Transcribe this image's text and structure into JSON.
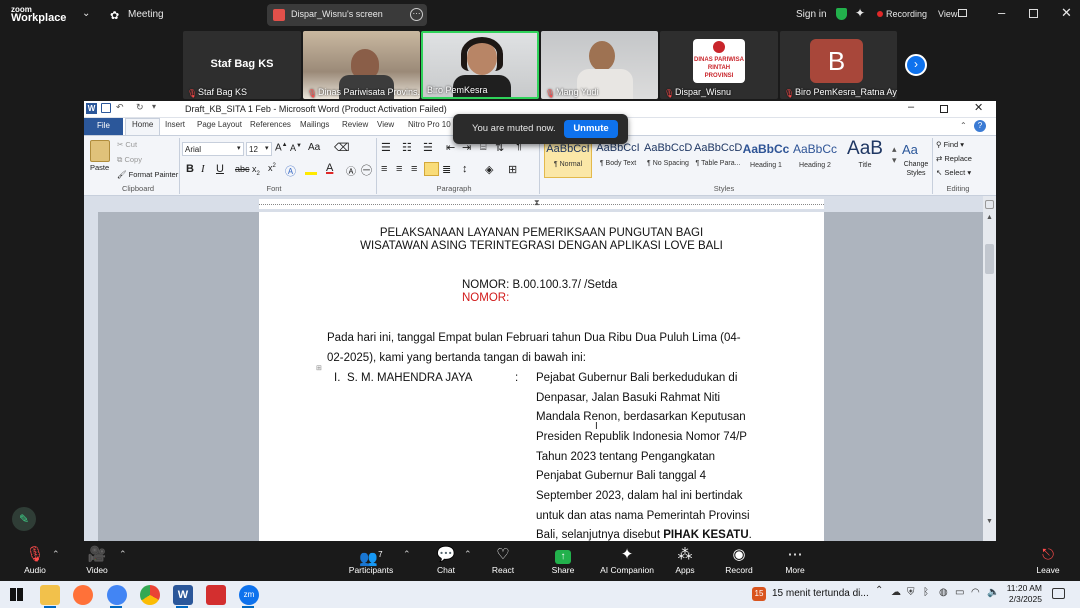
{
  "zoom": {
    "brand_line1": "zoom",
    "brand_line2": "Workplace",
    "meeting_label": "Meeting",
    "share_title": "Dispar_Wisnu's screen",
    "signin": "Sign in",
    "recording": "Recording",
    "view": "View"
  },
  "participants": [
    {
      "name": "Staf Bag KS",
      "placeholder": "Staf Bag KS"
    },
    {
      "name": "Dinas Pariwisata Provins..."
    },
    {
      "name": "Biro PemKesra"
    },
    {
      "name": "Mang Yudi"
    },
    {
      "name": "Dispar_Wisnu",
      "logo_text": "DINAS PARIWISA\nRINTAH PROVINSI"
    },
    {
      "name": "Biro PemKesra_Ratna Ayu",
      "initial": "B"
    }
  ],
  "word": {
    "title": "Draft_KB_SITA 1 Feb  -  Microsoft Word (Product Activation Failed)",
    "tabs": [
      "File",
      "Home",
      "Insert",
      "Page Layout",
      "References",
      "Mailings",
      "Review",
      "View",
      "Nitro Pro 10"
    ],
    "clipboard": {
      "paste": "Paste",
      "cut": "Cut",
      "copy": "Copy",
      "format_painter": "Format Painter",
      "group": "Clipboard"
    },
    "font": {
      "name": "Arial",
      "size": "12",
      "group": "Font"
    },
    "paragraph_group": "Paragraph",
    "styles": [
      {
        "sample": "AaBbCcI",
        "label": "¶ Normal"
      },
      {
        "sample": "AaBbCcI",
        "label": "¶ Body Text"
      },
      {
        "sample": "AaBbCcD",
        "label": "¶ No Spacing"
      },
      {
        "sample": "AaBbCcD",
        "label": "¶ Table Para..."
      },
      {
        "sample": "AaBbCc",
        "label": "Heading 1"
      },
      {
        "sample": "AaBbCc",
        "label": "Heading 2"
      },
      {
        "sample": "AaB",
        "label": "Title"
      }
    ],
    "styles_group": "Styles",
    "change_styles": "Change Styles",
    "editing": {
      "find": "Find",
      "replace": "Replace",
      "select": "Select",
      "group": "Editing"
    }
  },
  "toast": {
    "text": "You are muted now.",
    "button": "Unmute"
  },
  "document": {
    "title1": "PELAKSANAAN LAYANAN PEMERIKSAAN PUNGUTAN BAGI",
    "title2": "WISATAWAN ASING TERINTEGRASI DENGAN APLIKASI LOVE BALI",
    "nomor1": "NOMOR: B.00.100.3.7/      /Setda",
    "nomor2": "NOMOR:",
    "para1": "Pada  hari  ini,  tanggal  Empat  bulan  Februari  tahun  Dua  Ribu  Dua  Puluh  Lima  (04-",
    "para2": "02-2025), kami yang bertanda tangan di bawah ini:",
    "party_num": "I.",
    "party_name": "S. M. MAHENDRA JAYA",
    "colon": ":",
    "desc": [
      "Pejabat  Gubernur  Bali  berkedudukan  di",
      "Denpasar,   Jalan   Basuki   Rahmat   Niti",
      "Mandala  Renon,  berdasarkan  Keputusan",
      "Presiden  Republik  Indonesia  Nomor  74/P",
      "Tahun      2023      tentang      Pengangkatan",
      "Penjabat      Gubernur      Bali      tanggal      4",
      "September  2023,  dalam  hal  ini  bertindak",
      "untuk  dan  atas  nama  Pemerintah  Provinsi"
    ],
    "last_line_pre": "Bali, selanjutnya disebut ",
    "last_line_bold": "PIHAK KESATU",
    "last_line_post": "."
  },
  "toolbar": [
    {
      "label": "Audio"
    },
    {
      "label": "Video"
    },
    {
      "label": "Participants",
      "count": "7"
    },
    {
      "label": "Chat"
    },
    {
      "label": "React"
    },
    {
      "label": "Share"
    },
    {
      "label": "AI Companion"
    },
    {
      "label": "Apps"
    },
    {
      "label": "Record"
    },
    {
      "label": "More"
    },
    {
      "label": "Leave"
    }
  ],
  "taskbar": {
    "notification": "15 menit tertunda di...",
    "time": "11:20 AM",
    "date": "2/3/2025"
  },
  "colors": {
    "accent_blue": "#0e72ed",
    "share_green": "#22b14c",
    "record_red": "#e02828",
    "word_blue": "#2b579a"
  }
}
